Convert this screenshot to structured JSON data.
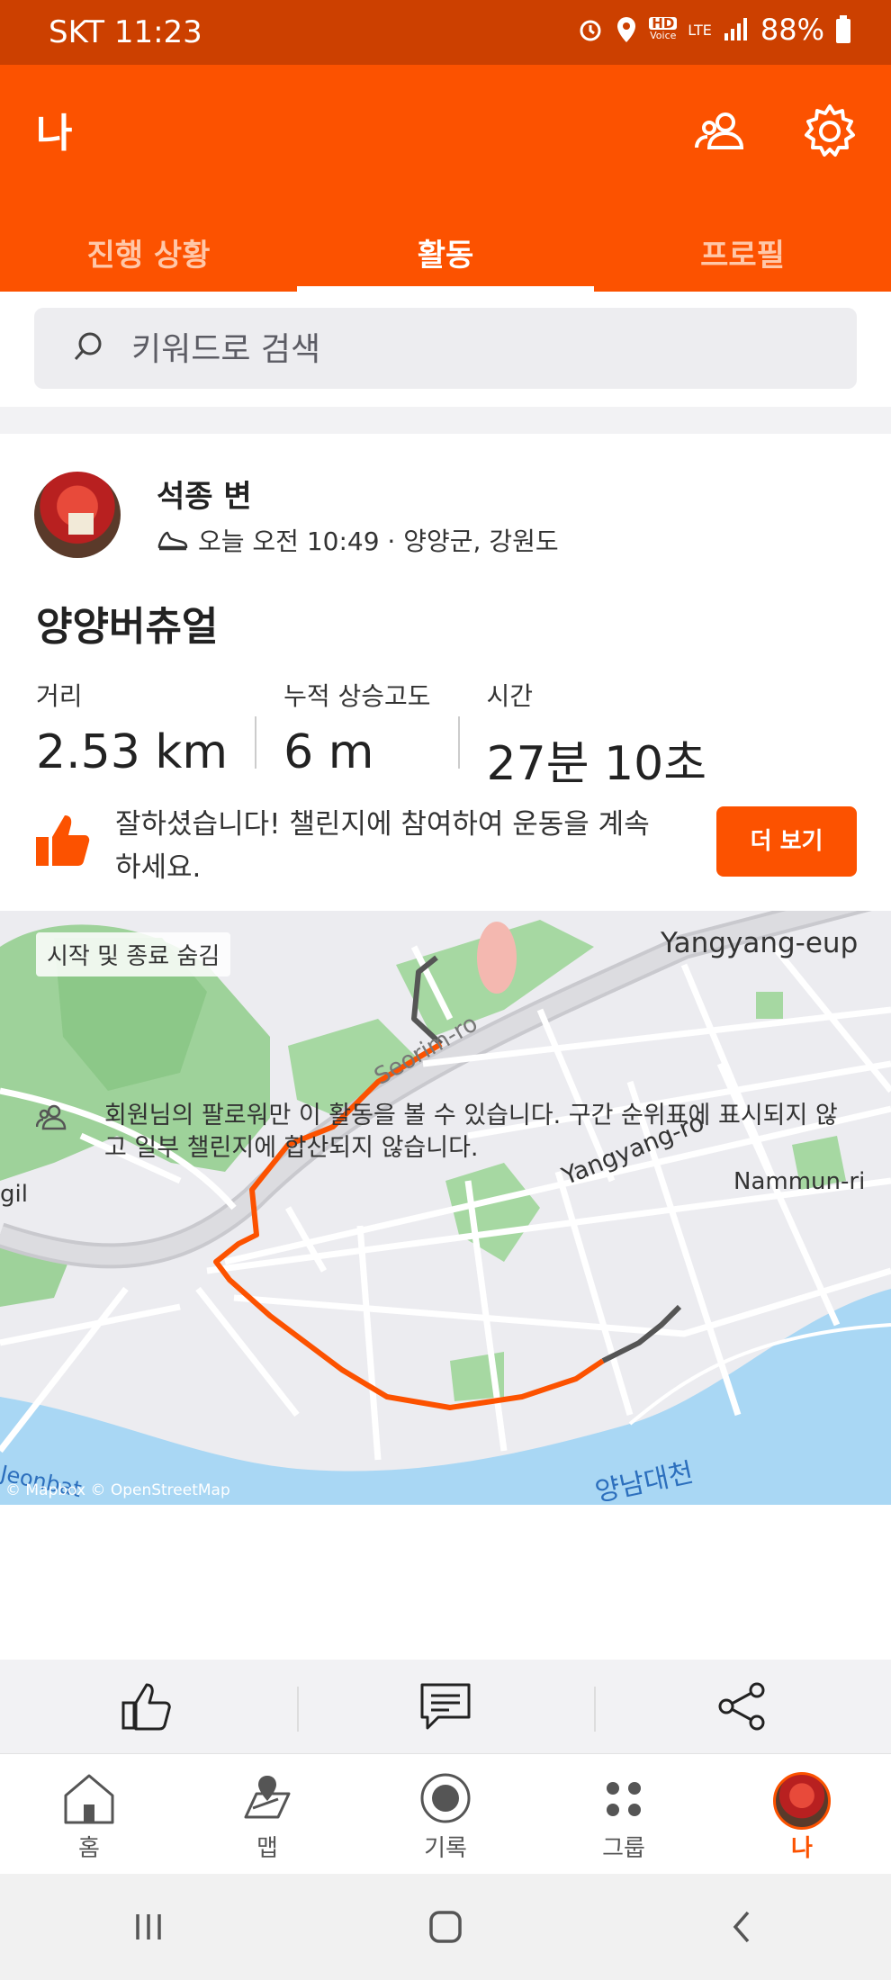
{
  "status_bar": {
    "carrier_time": "SKT 11:23",
    "battery": "88%",
    "hd_label": "HD",
    "voice_label": "Voice",
    "lte_label": "LTE"
  },
  "header": {
    "title": "나",
    "tabs": [
      {
        "label": "진행 상황"
      },
      {
        "label": "활동"
      },
      {
        "label": "프로필"
      }
    ]
  },
  "search": {
    "placeholder": "키워드로 검색"
  },
  "activity": {
    "athlete_name": "석종 변",
    "meta": "오늘 오전 10:49 · 양양군, 강원도",
    "title": "양양버츄얼",
    "stats": [
      {
        "label": "거리",
        "value": "2.53 km"
      },
      {
        "label": "누적 상승고도",
        "value": "6 m"
      },
      {
        "label": "시간",
        "value": "27분 10초"
      }
    ],
    "promo_text": "잘하셨습니다! 챌린지에 참여하여 운동을 계속하세요.",
    "promo_button": "더 보기",
    "map": {
      "hide_start_end": "시작 및 종료 숨김",
      "labels": [
        "Yangyang-eup",
        "Yangyang-ro",
        "Nammun-ri",
        "Seorim-ro",
        "gil",
        "양남대천",
        "Jeonbat"
      ],
      "attribution": "© Mapbox © OpenStreetMap"
    },
    "privacy_text": "회원님의 팔로워만 이 활동을 볼 수 있습니다. 구간 순위표에 표시되지 않고 일부 챌린지에 합산되지 않습니다."
  },
  "bottom_nav": [
    {
      "label": "홈",
      "icon": "home-icon"
    },
    {
      "label": "맵",
      "icon": "map-icon"
    },
    {
      "label": "기록",
      "icon": "record-icon"
    },
    {
      "label": "그룹",
      "icon": "groups-icon"
    },
    {
      "label": "나",
      "icon": "avatar"
    }
  ],
  "colors": {
    "brand": "#fc5200",
    "status_bar": "#cc4000"
  }
}
